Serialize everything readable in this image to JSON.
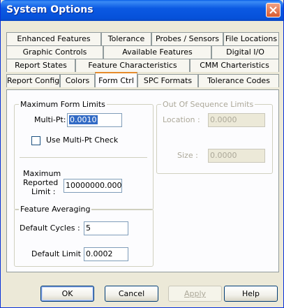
{
  "window": {
    "title": "System Options"
  },
  "tabs": {
    "row1": [
      "Enhanced Features",
      "Tolerance",
      "Probes / Sensors",
      "File Locations"
    ],
    "row2": [
      "Graphic Controls",
      "Available Features",
      "Digital I/O"
    ],
    "row3": [
      "Report States",
      "Feature Characteristics",
      "CMM Charteristics"
    ],
    "row4": [
      "Report Config",
      "Colors",
      "Form Ctrl",
      "SPC Formats",
      "Tolerance Codes"
    ],
    "active": "Form Ctrl"
  },
  "max_form_limits": {
    "legend": "Maximum Form Limits",
    "multi_pt_label": "Multi-Pt:",
    "multi_pt_value": "0.0010",
    "use_multi_pt_label": "Use Multi-Pt Check",
    "use_multi_pt_checked": false,
    "max_reported_label_1": "Maximum",
    "max_reported_label_2": "Reported",
    "max_reported_label_3": "Limit :",
    "max_reported_value": "10000000.0000"
  },
  "out_of_sequence": {
    "legend": "Out Of Sequence Limits",
    "location_label": "Location :",
    "location_value": "0.0000",
    "size_label": "Size :",
    "size_value": "0.0000",
    "enabled": false
  },
  "feature_averaging": {
    "legend": "Feature Averaging",
    "default_cycles_label": "Default Cycles :",
    "default_cycles_value": "5",
    "default_limit_label": "Default Limit :",
    "default_limit_value": "0.0002"
  },
  "buttons": {
    "ok": "OK",
    "cancel": "Cancel",
    "apply": "Apply",
    "help": "Help"
  },
  "colors": {
    "title_bar": "#0651d9",
    "dialog_face": "#ece9d8",
    "close_button": "#d85a30",
    "active_tab_accent": "#e68b2c"
  }
}
